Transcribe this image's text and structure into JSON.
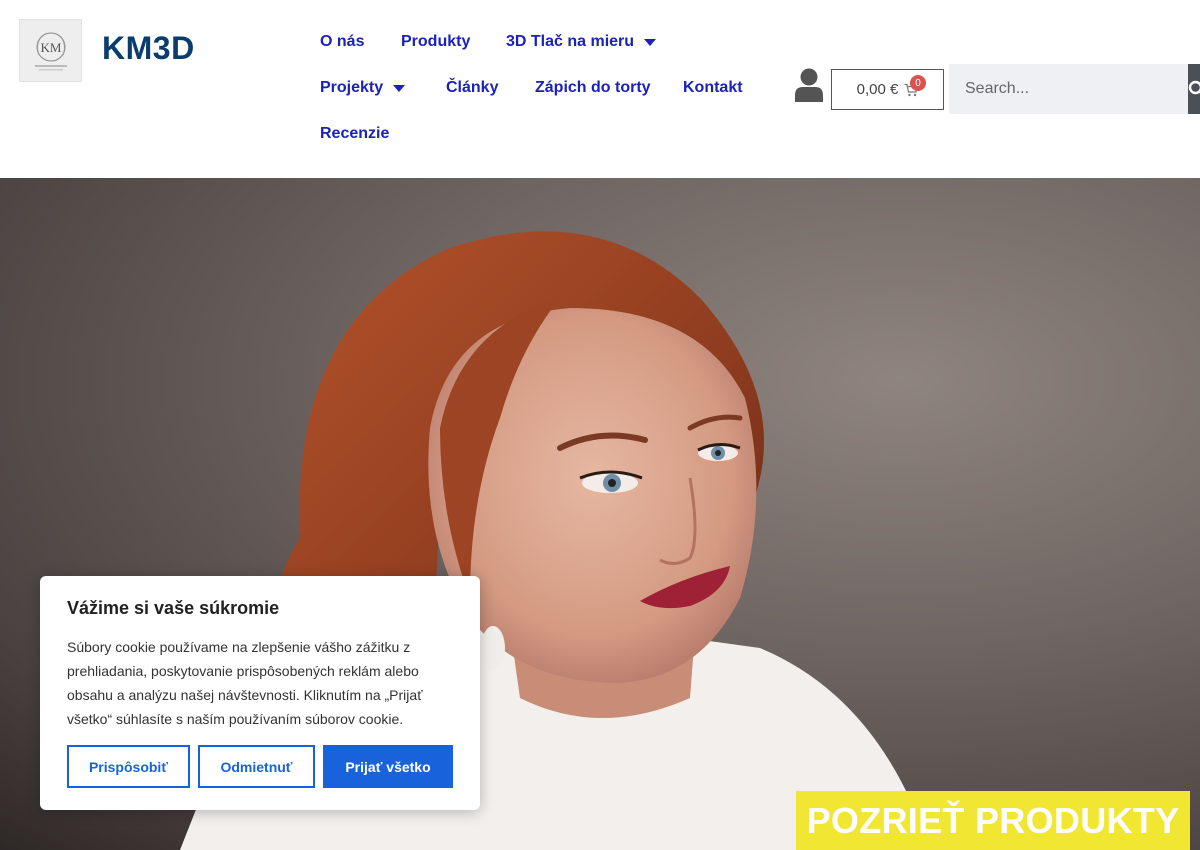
{
  "header": {
    "brand": "KM3D",
    "logo_text": "KM"
  },
  "nav": {
    "items": [
      {
        "label": "O nás"
      },
      {
        "label": "Produkty"
      },
      {
        "label": "3D Tlač na mieru"
      },
      {
        "label": "Projekty"
      },
      {
        "label": "Články"
      },
      {
        "label": "Zápich do torty"
      },
      {
        "label": "Kontakt"
      },
      {
        "label": "Recenzie"
      }
    ]
  },
  "cart": {
    "total": "0,00 €",
    "count": "0"
  },
  "search": {
    "placeholder": "Search..."
  },
  "cookie": {
    "title": "Vážime si vaše súkromie",
    "text": "Súbory cookie používame na zlepšenie vášho zážitku z prehliadania, poskytovanie prispôsobených reklám alebo obsahu a analýzu našej návštevnosti. Kliknutím na „Prijať všetko“ súhlasíte s naším používaním súborov cookie.",
    "customize_label": "Prispôsobiť",
    "reject_label": "Odmietnuť",
    "accept_label": "Prijať všetko"
  },
  "hero": {
    "cta_label": "POZRIEŤ PRODUKTY"
  },
  "colors": {
    "nav": "#1a22b8",
    "brand": "#0a3d6e",
    "cookie_button": "#1863dc",
    "cta": "#f1e632"
  }
}
